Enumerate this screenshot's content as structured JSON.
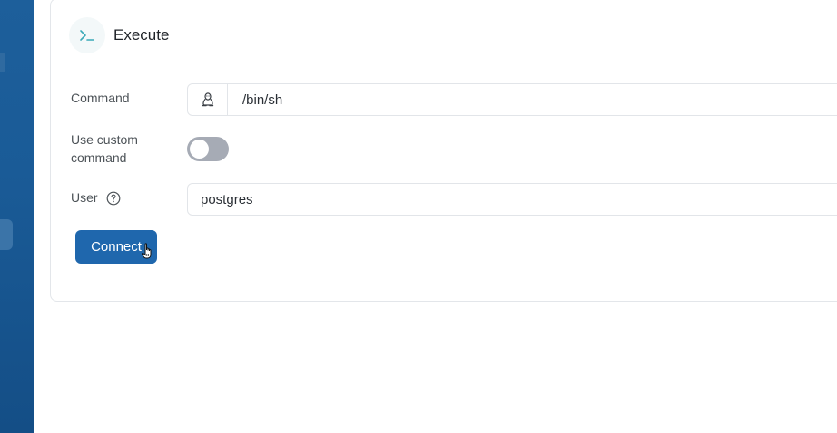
{
  "header": {
    "title": "Execute",
    "icon": "terminal-icon"
  },
  "form": {
    "command": {
      "label": "Command",
      "icon": "linux-tux-icon",
      "value": "/bin/sh"
    },
    "custom_command": {
      "label_line1": "Use custom",
      "label_line2": "command",
      "enabled": false
    },
    "user": {
      "label": "User",
      "help_icon": "question-circle-icon",
      "value": "postgres"
    }
  },
  "actions": {
    "connect_label": "Connect"
  },
  "colors": {
    "sidebar": "#1a5b97",
    "primary_button": "#1f67ad",
    "toggle_off": "#a6abb5",
    "terminal_icon": "#3aa9b8"
  }
}
